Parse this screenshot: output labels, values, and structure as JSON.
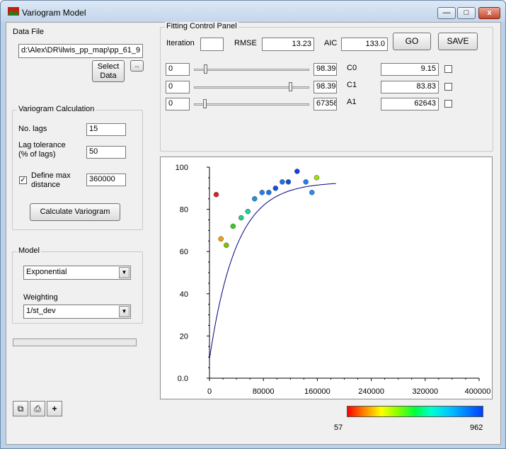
{
  "window": {
    "title": "Variogram Model",
    "min_label": "—",
    "max_label": "□",
    "close_label": "x"
  },
  "data_file": {
    "label": "Data File",
    "value": "d:\\Alex\\DR\\ilwis_pp_map\\pp_61_9",
    "select_label": "Select Data",
    "browse_label": ".."
  },
  "calc": {
    "group_title": "Variogram Calculation",
    "nlags_label": "No. lags",
    "nlags_value": "15",
    "lagtol_label_1": "Lag tolerance",
    "lagtol_label_2": "(% of lags)",
    "lagtol_value": "50",
    "define_max_label_1": "Define max",
    "define_max_label_2": "distance",
    "define_max_checked": true,
    "max_distance_value": "360000",
    "calculate_label": "Calculate Variogram"
  },
  "model": {
    "group_title": "Model",
    "model_value": "Exponential",
    "weighting_label": "Weighting",
    "weighting_value": "1/st_dev"
  },
  "fitting": {
    "group_title": "Fitting Control Panel",
    "iteration_label": "Iteration",
    "iteration_value": "",
    "rmse_label": "RMSE",
    "rmse_value": "13.23",
    "aic_label": "AIC",
    "aic_value": "133.0",
    "go_label": "GO",
    "save_label": "SAVE",
    "params": [
      {
        "min": "0",
        "max": "98.39",
        "name": "C0",
        "value": "9.15",
        "slider_fraction": 0.09,
        "fixed": false
      },
      {
        "min": "0",
        "max": "98.39",
        "name": "C1",
        "value": "83.83",
        "slider_fraction": 0.85,
        "fixed": false
      },
      {
        "min": "0",
        "max": "67358",
        "name": "A1",
        "value": "62643",
        "slider_fraction": 0.08,
        "fixed": false
      }
    ]
  },
  "chart_data": {
    "type": "scatter",
    "title": "",
    "xlabel": "",
    "ylabel": "",
    "xlim": [
      0,
      400000
    ],
    "ylim": [
      0,
      100
    ],
    "x_ticks": [
      "0",
      "80000",
      "160000",
      "240000",
      "320000",
      "400000"
    ],
    "y_ticks": [
      "0.0",
      "20",
      "40",
      "60",
      "80",
      "100"
    ],
    "points": [
      {
        "x": 10000,
        "y": 87,
        "color": "#e02020"
      },
      {
        "x": 17000,
        "y": 66,
        "color": "#f0a000"
      },
      {
        "x": 25000,
        "y": 63,
        "color": "#80c000"
      },
      {
        "x": 35000,
        "y": 72,
        "color": "#30d020"
      },
      {
        "x": 47000,
        "y": 76,
        "color": "#20d080"
      },
      {
        "x": 57000,
        "y": 79,
        "color": "#20d0a0"
      },
      {
        "x": 67000,
        "y": 85,
        "color": "#2090e0"
      },
      {
        "x": 78000,
        "y": 88,
        "color": "#2080f0"
      },
      {
        "x": 88000,
        "y": 88,
        "color": "#2070f0"
      },
      {
        "x": 98000,
        "y": 90,
        "color": "#1050e0"
      },
      {
        "x": 108000,
        "y": 93,
        "color": "#2070f0"
      },
      {
        "x": 117000,
        "y": 93,
        "color": "#1050e0"
      },
      {
        "x": 130000,
        "y": 98,
        "color": "#1040e0"
      },
      {
        "x": 143000,
        "y": 93,
        "color": "#2080f0"
      },
      {
        "x": 152000,
        "y": 88,
        "color": "#2090f0"
      },
      {
        "x": 159000,
        "y": 95,
        "color": "#a0e010"
      }
    ],
    "model_curve": {
      "type": "exponential",
      "nugget": 9.15,
      "sill": 83.83,
      "range": 62643
    },
    "colorbar": {
      "min_label": "57",
      "max_label": "962"
    }
  }
}
